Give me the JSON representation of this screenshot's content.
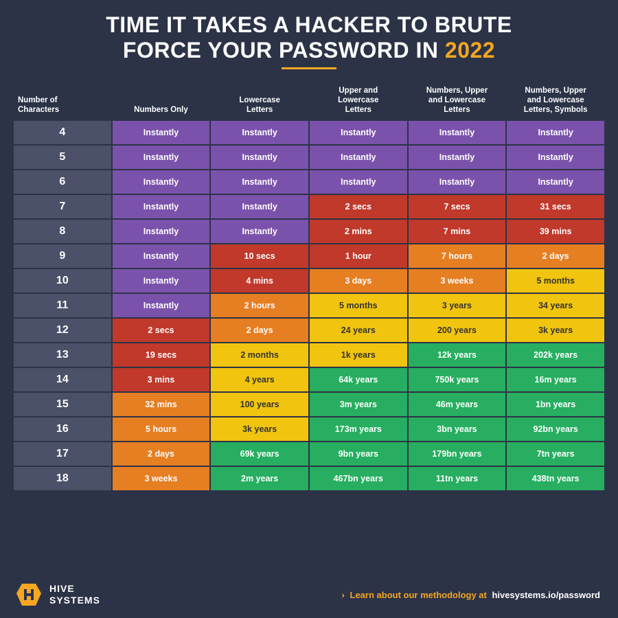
{
  "title": {
    "line1": "TIME IT TAKES A HACKER TO BRUTE",
    "line2_prefix": "FORCE YOUR PASSWORD IN ",
    "year": "2022"
  },
  "divider": true,
  "table": {
    "headers": [
      "Number of Characters",
      "Numbers Only",
      "Lowercase Letters",
      "Upper and Lowercase Letters",
      "Numbers, Upper and Lowercase Letters",
      "Numbers, Upper and Lowercase Letters, Symbols"
    ],
    "rows": [
      {
        "chars": "4",
        "cols": [
          "Instantly",
          "Instantly",
          "Instantly",
          "Instantly",
          "Instantly"
        ],
        "rowClass": "row-purple"
      },
      {
        "chars": "5",
        "cols": [
          "Instantly",
          "Instantly",
          "Instantly",
          "Instantly",
          "Instantly"
        ],
        "rowClass": "row-purple"
      },
      {
        "chars": "6",
        "cols": [
          "Instantly",
          "Instantly",
          "Instantly",
          "Instantly",
          "Instantly"
        ],
        "rowClass": "row-purple"
      },
      {
        "chars": "7",
        "cols": [
          "Instantly",
          "Instantly",
          "2 secs",
          "7 secs",
          "31 secs"
        ],
        "rowClass": "mixed7"
      },
      {
        "chars": "8",
        "cols": [
          "Instantly",
          "Instantly",
          "2 mins",
          "7 mins",
          "39 mins"
        ],
        "rowClass": "mixed8"
      },
      {
        "chars": "9",
        "cols": [
          "Instantly",
          "10 secs",
          "1 hour",
          "7 hours",
          "2 days"
        ],
        "rowClass": "mixed9"
      },
      {
        "chars": "10",
        "cols": [
          "Instantly",
          "4 mins",
          "3 days",
          "3 weeks",
          "5 months"
        ],
        "rowClass": "mixed10"
      },
      {
        "chars": "11",
        "cols": [
          "Instantly",
          "2 hours",
          "5 months",
          "3 years",
          "34 years"
        ],
        "rowClass": "mixed11"
      },
      {
        "chars": "12",
        "cols": [
          "2 secs",
          "2 days",
          "24 years",
          "200 years",
          "3k years"
        ],
        "rowClass": "mixed12"
      },
      {
        "chars": "13",
        "cols": [
          "19 secs",
          "2 months",
          "1k years",
          "12k years",
          "202k years"
        ],
        "rowClass": "mixed13"
      },
      {
        "chars": "14",
        "cols": [
          "3 mins",
          "4 years",
          "64k years",
          "750k years",
          "16m years"
        ],
        "rowClass": "mixed14"
      },
      {
        "chars": "15",
        "cols": [
          "32 mins",
          "100 years",
          "3m years",
          "46m years",
          "1bn years"
        ],
        "rowClass": "mixed15"
      },
      {
        "chars": "16",
        "cols": [
          "5 hours",
          "3k years",
          "173m years",
          "3bn years",
          "92bn years"
        ],
        "rowClass": "mixed16"
      },
      {
        "chars": "17",
        "cols": [
          "2 days",
          "69k years",
          "9bn years",
          "179bn years",
          "7tn years"
        ],
        "rowClass": "mixed17"
      },
      {
        "chars": "18",
        "cols": [
          "3 weeks",
          "2m years",
          "467bn years",
          "11tn years",
          "438tn years"
        ],
        "rowClass": "mixed18"
      }
    ]
  },
  "footer": {
    "logo_line1": "HIVE",
    "logo_line2": "SYSTEMS",
    "arrow": "›",
    "link_text": "Learn about our methodology at",
    "url": "hivesystems.io/password"
  }
}
